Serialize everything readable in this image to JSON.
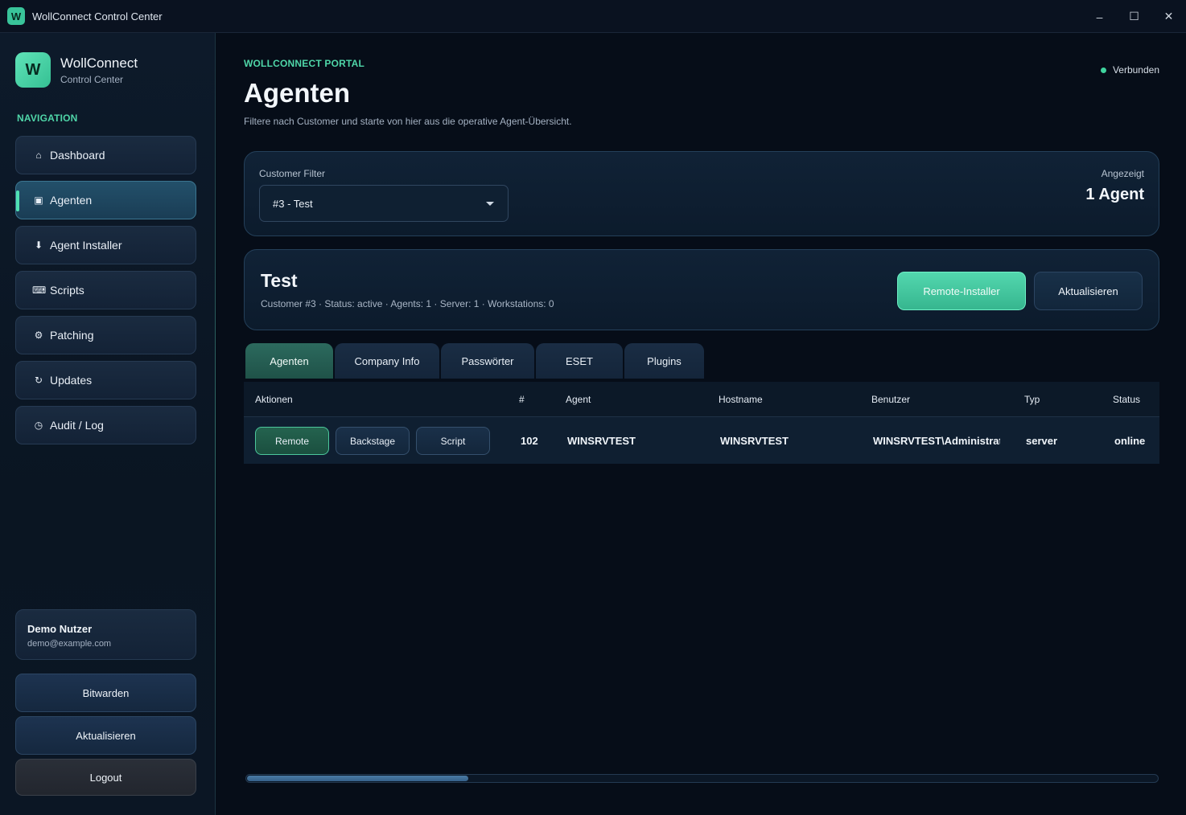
{
  "window": {
    "title": "WollConnect Control Center",
    "icon_letter": "W",
    "minimize": "–",
    "maximize": "☐",
    "close": "✕"
  },
  "sidebar": {
    "brand_letter": "W",
    "brand_name": "WollConnect",
    "brand_sub": "Control Center",
    "nav_heading": "NAVIGATION",
    "items": [
      {
        "label": "Dashboard",
        "icon": "⌂"
      },
      {
        "label": "Agenten",
        "icon": "▣"
      },
      {
        "label": "Agent Installer",
        "icon": "⬇"
      },
      {
        "label": "Scripts",
        "icon": "⌨"
      },
      {
        "label": "Patching",
        "icon": "⚙"
      },
      {
        "label": "Updates",
        "icon": "↻"
      },
      {
        "label": "Audit / Log",
        "icon": "◷"
      }
    ],
    "user": {
      "name": "Demo Nutzer",
      "email": "demo@example.com"
    },
    "bitwarden": "Bitwarden",
    "refresh": "Aktualisieren",
    "logout": "Logout"
  },
  "header": {
    "eyebrow": "WOLLCONNECT PORTAL",
    "title": "Agenten",
    "description": "Filtere nach Customer und starte von hier aus die operative Agent-Übersicht.",
    "connection": "Verbunden"
  },
  "filter": {
    "label": "Customer Filter",
    "selected": "#3 - Test",
    "shown_label": "Angezeigt",
    "shown_value": "1 Agent"
  },
  "customer": {
    "name": "Test",
    "meta": "Customer #3 · Status: active · Agents: 1 · Server: 1 · Workstations: 0",
    "remote_installer": "Remote-Installer",
    "refresh": "Aktualisieren"
  },
  "tabs": [
    "Agenten",
    "Company Info",
    "Passwörter",
    "ESET",
    "Plugins"
  ],
  "table": {
    "columns": [
      "Aktionen",
      "#",
      "Agent",
      "Hostname",
      "Benutzer",
      "Typ",
      "Status"
    ],
    "rows": [
      {
        "actions": [
          "Remote",
          "Backstage",
          "Script"
        ],
        "id": "102",
        "agent": "WINSRVTEST",
        "hostname": "WINSRVTEST",
        "user": "WINSRVTEST\\Administrato",
        "type": "server",
        "status": "online"
      }
    ]
  },
  "colors": {
    "accent": "#4fd6a8",
    "primary_button": "#53d7ae",
    "active_nav": "#23506a",
    "status_online": "#3fd39e",
    "background": "#060d18"
  }
}
